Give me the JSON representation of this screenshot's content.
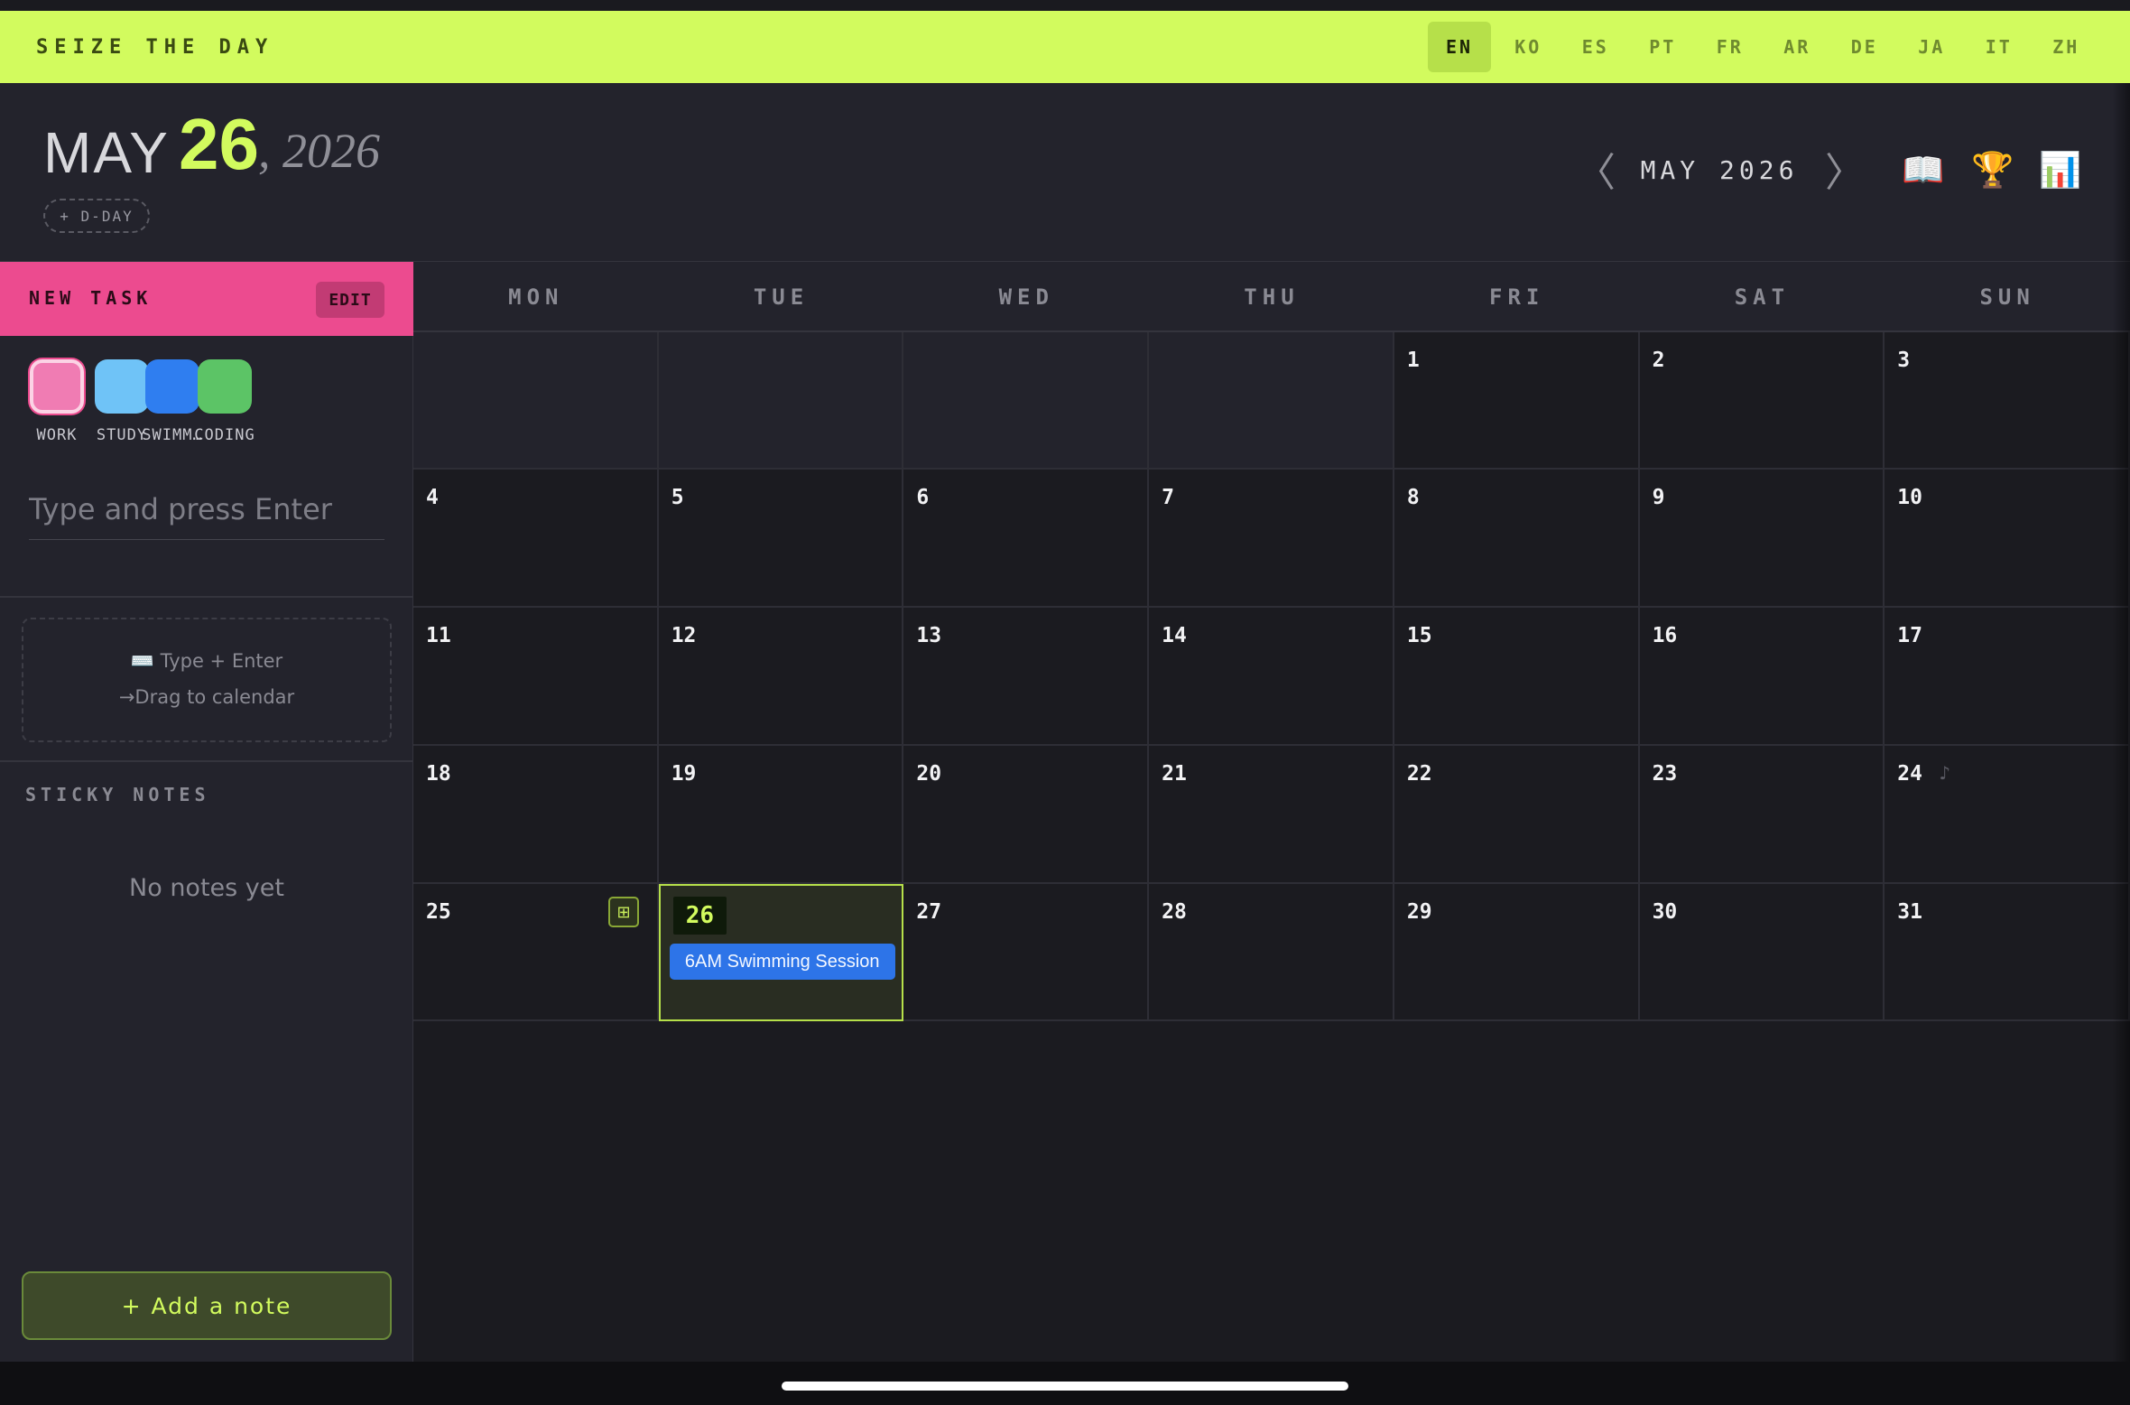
{
  "app": {
    "brand": "SEIZE THE DAY"
  },
  "languages": [
    "EN",
    "KO",
    "ES",
    "PT",
    "FR",
    "AR",
    "DE",
    "JA",
    "IT",
    "ZH"
  ],
  "active_language": "EN",
  "header": {
    "month": "MAY",
    "day": "26",
    "year": ", 2026",
    "dday_label": "+ D-DAY",
    "prev_icon": "chevron-left-icon",
    "next_icon": "chevron-right-icon",
    "month_label": "MAY 2026",
    "prev_glyph": "〈",
    "next_glyph": "〉",
    "icons": {
      "book": "📖",
      "trophy": "🏆",
      "chart": "📊"
    }
  },
  "sidebar": {
    "new_task_label": "NEW TASK",
    "edit_label": "EDIT",
    "categories": [
      {
        "label": "WORK",
        "color": "#f07cb3",
        "selected": true
      },
      {
        "label": "STUDY",
        "color": "#6fc3f7"
      },
      {
        "label": "SWIMM…",
        "color": "#2f7ef0"
      },
      {
        "label": "CODING",
        "color": "#5cc466"
      }
    ],
    "task_input": {
      "placeholder": "Type and press Enter",
      "value": ""
    },
    "hints": {
      "line1": "⌨️ Type + Enter",
      "line2": "→Drag to calendar"
    },
    "sticky_notes_title": "STICKY NOTES",
    "no_notes_text": "No notes yet",
    "add_note_label": "+ Add a note"
  },
  "calendar": {
    "weekdays": [
      "MON",
      "TUE",
      "WED",
      "THU",
      "FRI",
      "SAT",
      "SUN"
    ],
    "weeks": [
      [
        "",
        "",
        "",
        "",
        "1",
        "2",
        "3"
      ],
      [
        "4",
        "5",
        "6",
        "7",
        "8",
        "9",
        "10"
      ],
      [
        "11",
        "12",
        "13",
        "14",
        "15",
        "16",
        "17"
      ],
      [
        "18",
        "19",
        "20",
        "21",
        "22",
        "23",
        "24"
      ],
      [
        "25",
        "26",
        "27",
        "28",
        "29",
        "30",
        "31"
      ]
    ],
    "today": "26",
    "note_day": "25",
    "note_icon_glyph": "⊞",
    "music_day": "24",
    "music_glyph": "♪",
    "events": [
      {
        "day": "26",
        "label": "6AM Swimming Session",
        "color": "#2d74e8"
      }
    ]
  }
}
